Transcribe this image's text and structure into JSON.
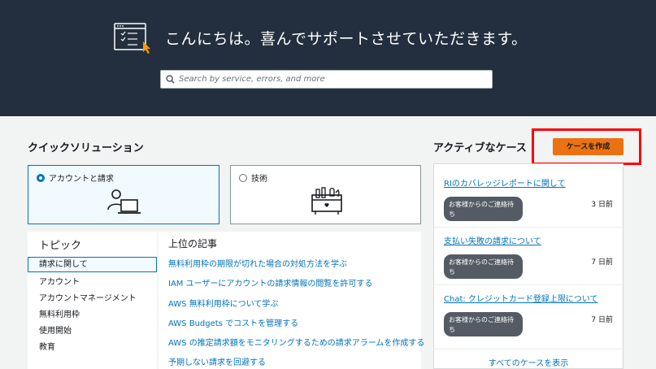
{
  "hero": {
    "title": "こんにちは。喜んでサポートさせていただきます。",
    "search_placeholder": "Search by service, errors, and more",
    "icons": [
      "support-window-icon",
      "search-icon"
    ]
  },
  "quick_solutions": {
    "title": "クイックソリューション",
    "tiles": [
      {
        "label": "アカウントと請求",
        "selected": true,
        "icon": "account-billing-icon"
      },
      {
        "label": "技術",
        "selected": false,
        "icon": "technical-toolbox-icon"
      }
    ]
  },
  "topics": {
    "title": "トピック",
    "items": [
      {
        "label": "請求に関して",
        "active": true
      },
      {
        "label": "アカウント",
        "active": false
      },
      {
        "label": "アカウントマネージメント",
        "active": false
      },
      {
        "label": "無料利用枠",
        "active": false
      },
      {
        "label": "使用開始",
        "active": false
      },
      {
        "label": "教育",
        "active": false
      }
    ]
  },
  "articles": {
    "title": "上位の記事",
    "items": [
      "無料利用枠の期限が切れた場合の対処方法を学ぶ",
      "IAM ユーザーにアカウントの請求情報の閲覧を許可する",
      "AWS 無料利用枠について学ぶ",
      "AWS Budgets でコストを管理する",
      "AWS の推定請求額をモニタリングするための請求アラームを作成する",
      "予期しない請求を回避する"
    ]
  },
  "active_cases": {
    "title": "アクティブなケース",
    "create_label": "ケースを作成",
    "cases": [
      {
        "title": "RIのカバレッジレポートに関して",
        "status": "お客様からのご連絡待ち",
        "age": "3 日前"
      },
      {
        "title": "支払い失敗の請求について",
        "status": "お客様からのご連絡待ち",
        "age": "7 日前"
      },
      {
        "title": "Chat: クレジットカード登録上限について",
        "status": "お客様からのご連絡待ち",
        "age": "7 日前"
      }
    ],
    "view_all_label": "すべてのケースを表示"
  },
  "colors": {
    "header_bg": "#232f3e",
    "link": "#0073bb",
    "primary_button": "#ec7211",
    "highlight": "#ff0000",
    "badge_bg": "#545b64"
  }
}
